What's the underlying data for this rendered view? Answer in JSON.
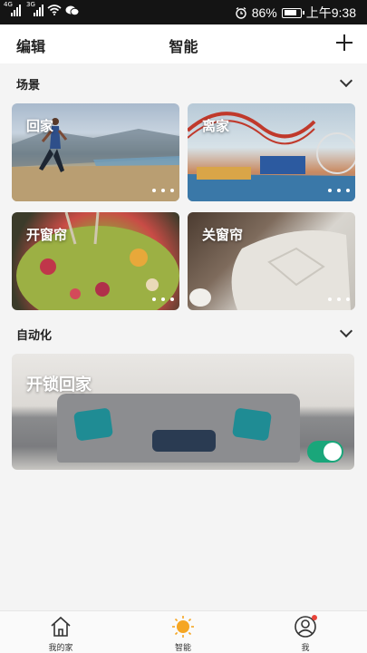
{
  "status_bar": {
    "sig1_net": "4G",
    "sig2_net": "3G",
    "battery": "86%",
    "time": "上午9:38"
  },
  "header": {
    "left": "编辑",
    "title": "智能"
  },
  "scenes": {
    "section_label": "场景",
    "cards": [
      {
        "title": "回家"
      },
      {
        "title": "离家"
      },
      {
        "title": "开窗帘"
      },
      {
        "title": "关窗帘"
      }
    ]
  },
  "automation": {
    "section_label": "自动化",
    "card_title": "开锁回家",
    "enabled": true
  },
  "tabs": [
    {
      "label": "我的家",
      "icon": "home-icon"
    },
    {
      "label": "智能",
      "icon": "sun-icon"
    },
    {
      "label": "我",
      "icon": "user-icon"
    }
  ],
  "colors": {
    "accent_orange": "#f5a623",
    "toggle_on": "#1aa67a",
    "notification": "#e8443a"
  }
}
